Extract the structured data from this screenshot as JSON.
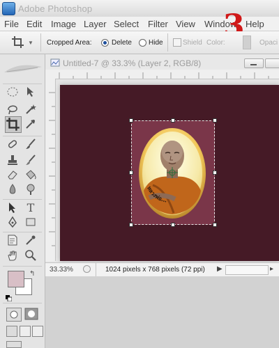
{
  "window": {
    "app_title": "Adobe Photoshop"
  },
  "menu": [
    "File",
    "Edit",
    "Image",
    "Layer",
    "Select",
    "Filter",
    "View",
    "Window",
    "Help"
  ],
  "options_bar": {
    "cropped_area_label": "Cropped Area:",
    "delete_label": "Delete",
    "hide_label": "Hide",
    "shield_label": "Shield",
    "color_label": "Color:",
    "opacity_label": "Opaci",
    "selected_option": "Delete"
  },
  "step_number": "3",
  "document": {
    "title": "Untitled-7 @ 33.3% (Layer 2, RGB/8)",
    "zoom": "33.33%",
    "dimensions": "1024 pixels x 768 pixels (72 ppi)"
  },
  "photo": {
    "caption": "หลวงพ่อ…"
  },
  "colors": {
    "canvas": "#451a26",
    "crop_area": "#7a3649",
    "foreground_swatch": "#d8bfc6",
    "step_number": "#d01818"
  },
  "icons": [
    "photoshop-logo-icon",
    "crop-tool-icon",
    "marquee-icon",
    "move-icon",
    "lasso-icon",
    "magic-wand-icon",
    "brush-icon",
    "clone-stamp-icon",
    "eraser-icon",
    "bucket-icon",
    "pen-icon",
    "type-icon",
    "path-select-icon",
    "shape-icon",
    "notes-icon",
    "eyedropper-icon",
    "hand-icon",
    "zoom-icon"
  ]
}
